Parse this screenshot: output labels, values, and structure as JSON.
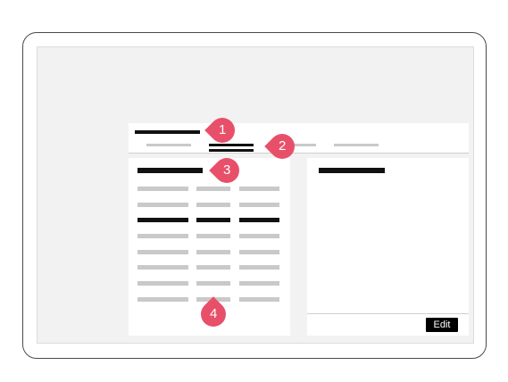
{
  "detail": {
    "edit_label": "Edit"
  },
  "callouts": [
    {
      "number": "1",
      "target": "title"
    },
    {
      "number": "2",
      "target": "tabs"
    },
    {
      "number": "3",
      "target": "list-heading"
    },
    {
      "number": "4",
      "target": "list-rows"
    }
  ],
  "colors": {
    "callout": "#e8506a",
    "placeholder_muted": "#c9c9c9",
    "placeholder_active": "#111111",
    "button": "#000000"
  }
}
